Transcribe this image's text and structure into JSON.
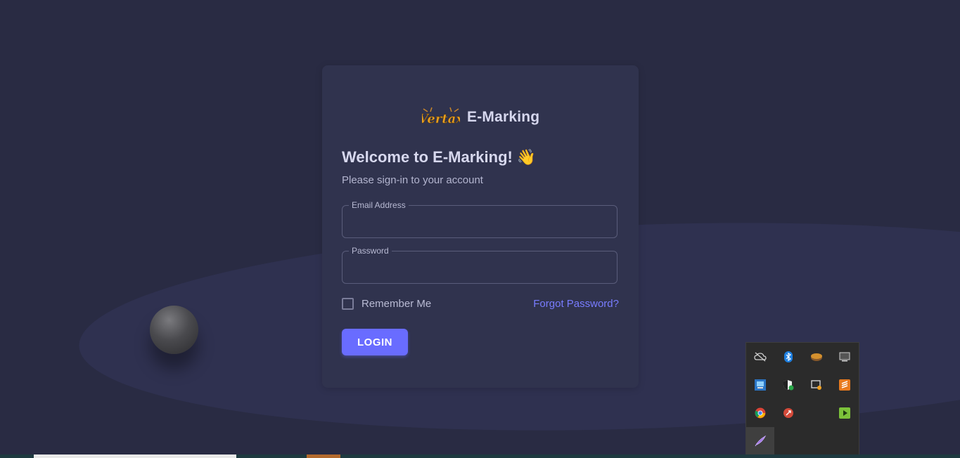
{
  "brand": {
    "logo_text": "Vertax",
    "name": "E-Marking"
  },
  "login": {
    "welcome": "Welcome to E-Marking!",
    "wave_emoji": "👋",
    "subtitle": "Please sign-in to your account",
    "email_label": "Email Address",
    "email_value": "",
    "password_label": "Password",
    "password_value": "",
    "remember_label": "Remember Me",
    "remember_checked": false,
    "forgot_label": "Forgot Password?",
    "login_label": "LOGIN"
  },
  "colors": {
    "background": "#292b43",
    "card": "#30334e",
    "primary": "#696cff",
    "link": "#787cff"
  },
  "tray": {
    "icons": [
      "cloud-offline-icon",
      "bluetooth-icon",
      "disk-icon",
      "monitor-icon",
      "network-app-icon",
      "security-shield-icon",
      "screen-capture-icon",
      "sublime-icon",
      "chrome-icon",
      "red-app-icon",
      "green-play-icon",
      "purple-feather-icon"
    ]
  }
}
